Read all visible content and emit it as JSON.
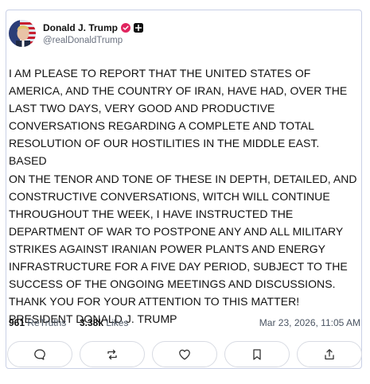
{
  "author": {
    "display_name": "Donald J. Trump",
    "handle": "@realDonaldTrump",
    "avatar_icon": "profile-photo",
    "verified_color": "#e0245e"
  },
  "post": {
    "body": "I AM PLEASE TO REPORT THAT THE UNITED STATES OF\nAMERICA, AND THE COUNTRY OF IRAN, HAVE HAD, OVER THE\nLAST TWO DAYS, VERY GOOD AND PRODUCTIVE\nCONVERSATIONS REGARDING A COMPLETE AND TOTAL\nRESOLUTION OF OUR HOSTILITIES IN THE MIDDLE EAST. BASED\nON THE TENOR AND TONE OF THESE IN DEPTH, DETAILED, AND\nCONSTRUCTIVE CONVERSATIONS, WITCH WILL CONTINUE\nTHROUGHOUT THE WEEK, I HAVE INSTRUCTED THE\nDEPARTMENT OF WAR TO POSTPONE ANY AND ALL MILITARY\nSTRIKES AGAINST IRANIAN POWER PLANTS AND ENERGY\nINFRASTRUCTURE FOR A FIVE DAY PERIOD, SUBJECT TO THE\nSUCCESS OF THE ONGOING MEETINGS AND DISCUSSIONS.\nTHANK YOU FOR YOUR ATTENTION TO THIS MATTER!\nPRESIDENT DONALD J. TRUMP"
  },
  "stats": {
    "retruths_count": "961",
    "retruths_label": "ReTruths",
    "likes_count": "3.38k",
    "likes_label": "Likes",
    "timestamp": "Mar 23, 2026, 11:05 AM"
  },
  "actions": [
    {
      "icon": "reply-icon"
    },
    {
      "icon": "retruth-icon"
    },
    {
      "icon": "like-icon"
    },
    {
      "icon": "bookmark-icon"
    },
    {
      "icon": "share-icon"
    }
  ]
}
